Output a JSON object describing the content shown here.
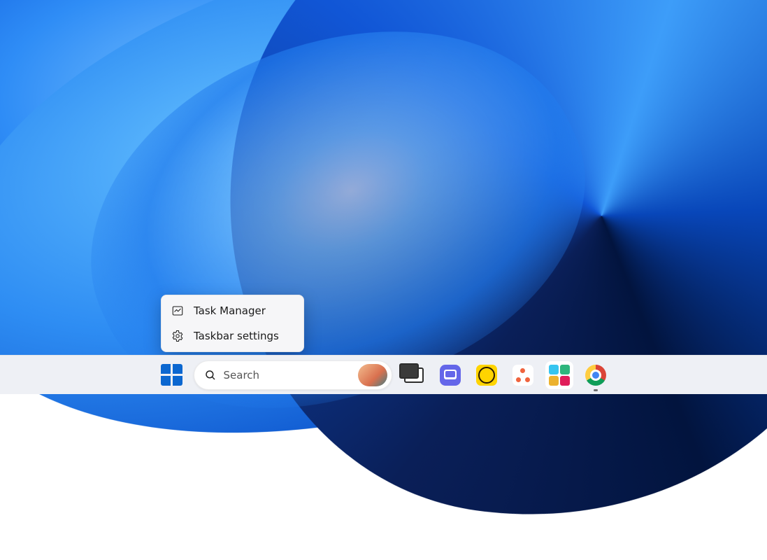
{
  "context_menu": {
    "items": [
      {
        "label": "Task Manager"
      },
      {
        "label": "Taskbar settings"
      }
    ]
  },
  "taskbar": {
    "search_placeholder": "Search"
  }
}
